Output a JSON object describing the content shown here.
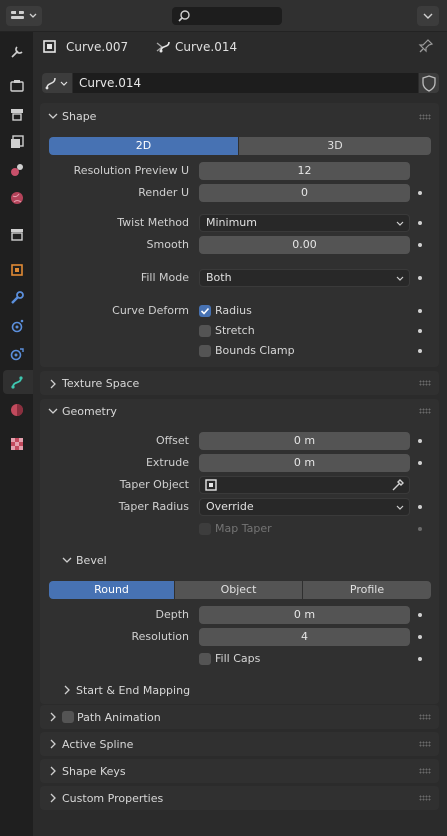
{
  "header": {
    "object_name": "Curve.007",
    "data_name": "Curve.014"
  },
  "datablock": {
    "name": "Curve.014"
  },
  "shape": {
    "title": "Shape",
    "dim_2d": "2D",
    "dim_3d": "3D",
    "resolution_preview_u_label": "Resolution Preview U",
    "resolution_preview_u": "12",
    "render_u_label": "Render U",
    "render_u": "0",
    "twist_method_label": "Twist Method",
    "twist_method": "Minimum",
    "smooth_label": "Smooth",
    "smooth": "0.00",
    "fill_mode_label": "Fill Mode",
    "fill_mode": "Both",
    "curve_deform_label": "Curve Deform",
    "radius_label": "Radius",
    "stretch_label": "Stretch",
    "bounds_clamp_label": "Bounds Clamp"
  },
  "texture_space": {
    "title": "Texture Space"
  },
  "geometry": {
    "title": "Geometry",
    "offset_label": "Offset",
    "offset": "0 m",
    "extrude_label": "Extrude",
    "extrude": "0 m",
    "taper_object_label": "Taper Object",
    "taper_radius_label": "Taper Radius",
    "taper_radius": "Override",
    "map_taper_label": "Map Taper",
    "bevel": {
      "title": "Bevel",
      "mode_round": "Round",
      "mode_object": "Object",
      "mode_profile": "Profile",
      "depth_label": "Depth",
      "depth": "0 m",
      "resolution_label": "Resolution",
      "resolution": "4",
      "fill_caps_label": "Fill Caps"
    },
    "start_end_mapping": {
      "title": "Start & End Mapping"
    }
  },
  "path_animation": {
    "title": "Path Animation"
  },
  "active_spline": {
    "title": "Active Spline"
  },
  "shape_keys": {
    "title": "Shape Keys"
  },
  "custom_properties": {
    "title": "Custom Properties"
  },
  "colors": {
    "accent": "#4772b3",
    "curve_data_tab": "#3ec7b0"
  }
}
